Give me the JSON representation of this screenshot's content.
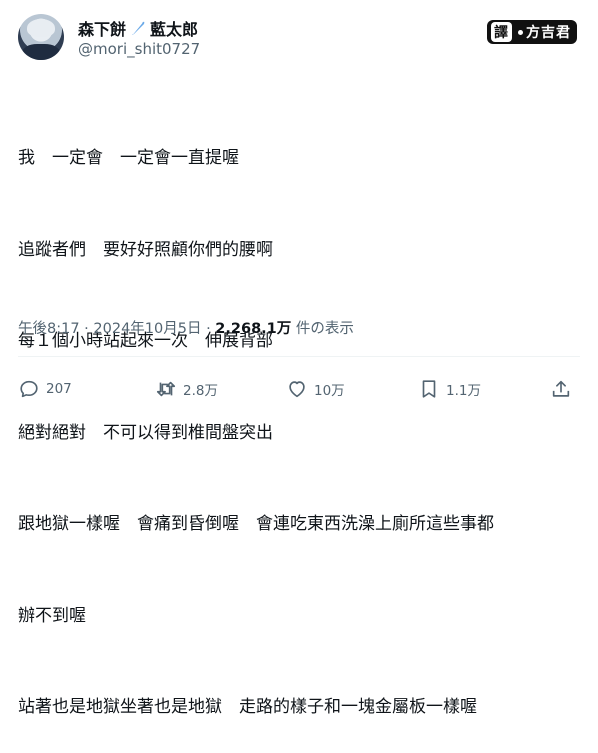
{
  "author": {
    "display_name": "森下餅",
    "display_name_suffix": "藍太郎",
    "handle": "@mori_shit0727"
  },
  "badge": {
    "label_left": "譯",
    "label_right": "方吉君"
  },
  "tweet": {
    "lines": [
      "我　一定會　一定會一直提喔",
      "追蹤者們　要好好照顧你們的腰啊",
      "每１個小時站起來一次　伸展背部",
      "絕對絕對　不可以得到椎間盤突出",
      "跟地獄一樣喔　會痛到昏倒喔　會連吃東西洗澡上廁所這些事都",
      "辦不到喔",
      "站著也是地獄坐著也是地獄　走路的樣子和一塊金屬板一樣喔"
    ]
  },
  "meta": {
    "time": "午後8:17",
    "separator": " · ",
    "date": "2024年10月5日",
    "views": "2,268.1万",
    "views_label": " 件の表示"
  },
  "actions": {
    "replies": "207",
    "reposts": "2.8万",
    "likes": "10万",
    "bookmarks": "1.1万"
  }
}
